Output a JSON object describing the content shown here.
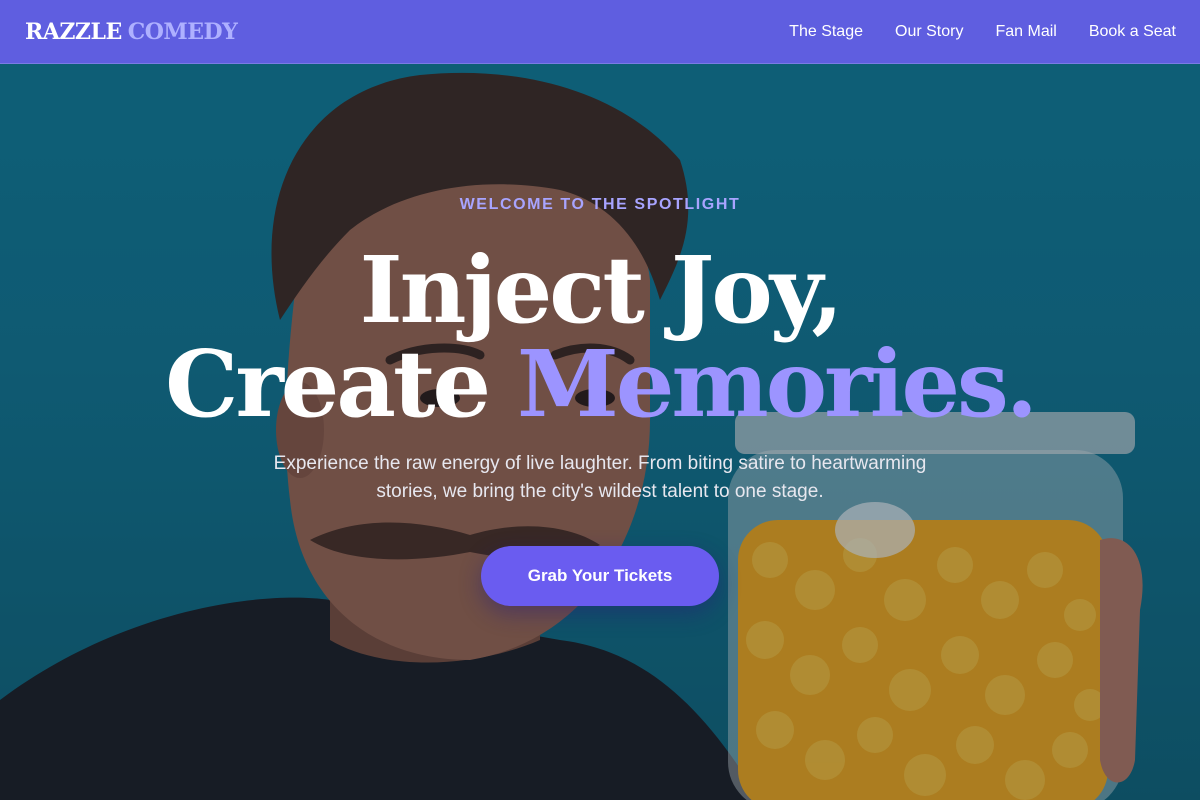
{
  "brand": {
    "name_primary": "RAZZLE",
    "name_accent": "COMEDY"
  },
  "nav": {
    "items": [
      {
        "label": "The Stage"
      },
      {
        "label": "Our Story"
      },
      {
        "label": "Fan Mail"
      },
      {
        "label": "Book a Seat"
      }
    ]
  },
  "hero": {
    "eyebrow": "WELCOME TO THE SPOTLIGHT",
    "headline_line1": "Inject Joy,",
    "headline_line2_white": "Create",
    "headline_line2_accent": "Memories.",
    "subtext": "Experience the raw energy of live laughter. From biting satire to heartwarming stories, we bring the city's wildest talent to one stage.",
    "cta_label": "Grab Your Tickets",
    "background_image": "man-with-mustache-holding-jar-of-cheese-puffs"
  },
  "colors": {
    "nav_bg": "#5f5ee0",
    "accent": "#9c94ff",
    "eyebrow": "#a8a4ff",
    "cta_bg": "#6a5cf0",
    "hero_bg": "#0f7690"
  }
}
